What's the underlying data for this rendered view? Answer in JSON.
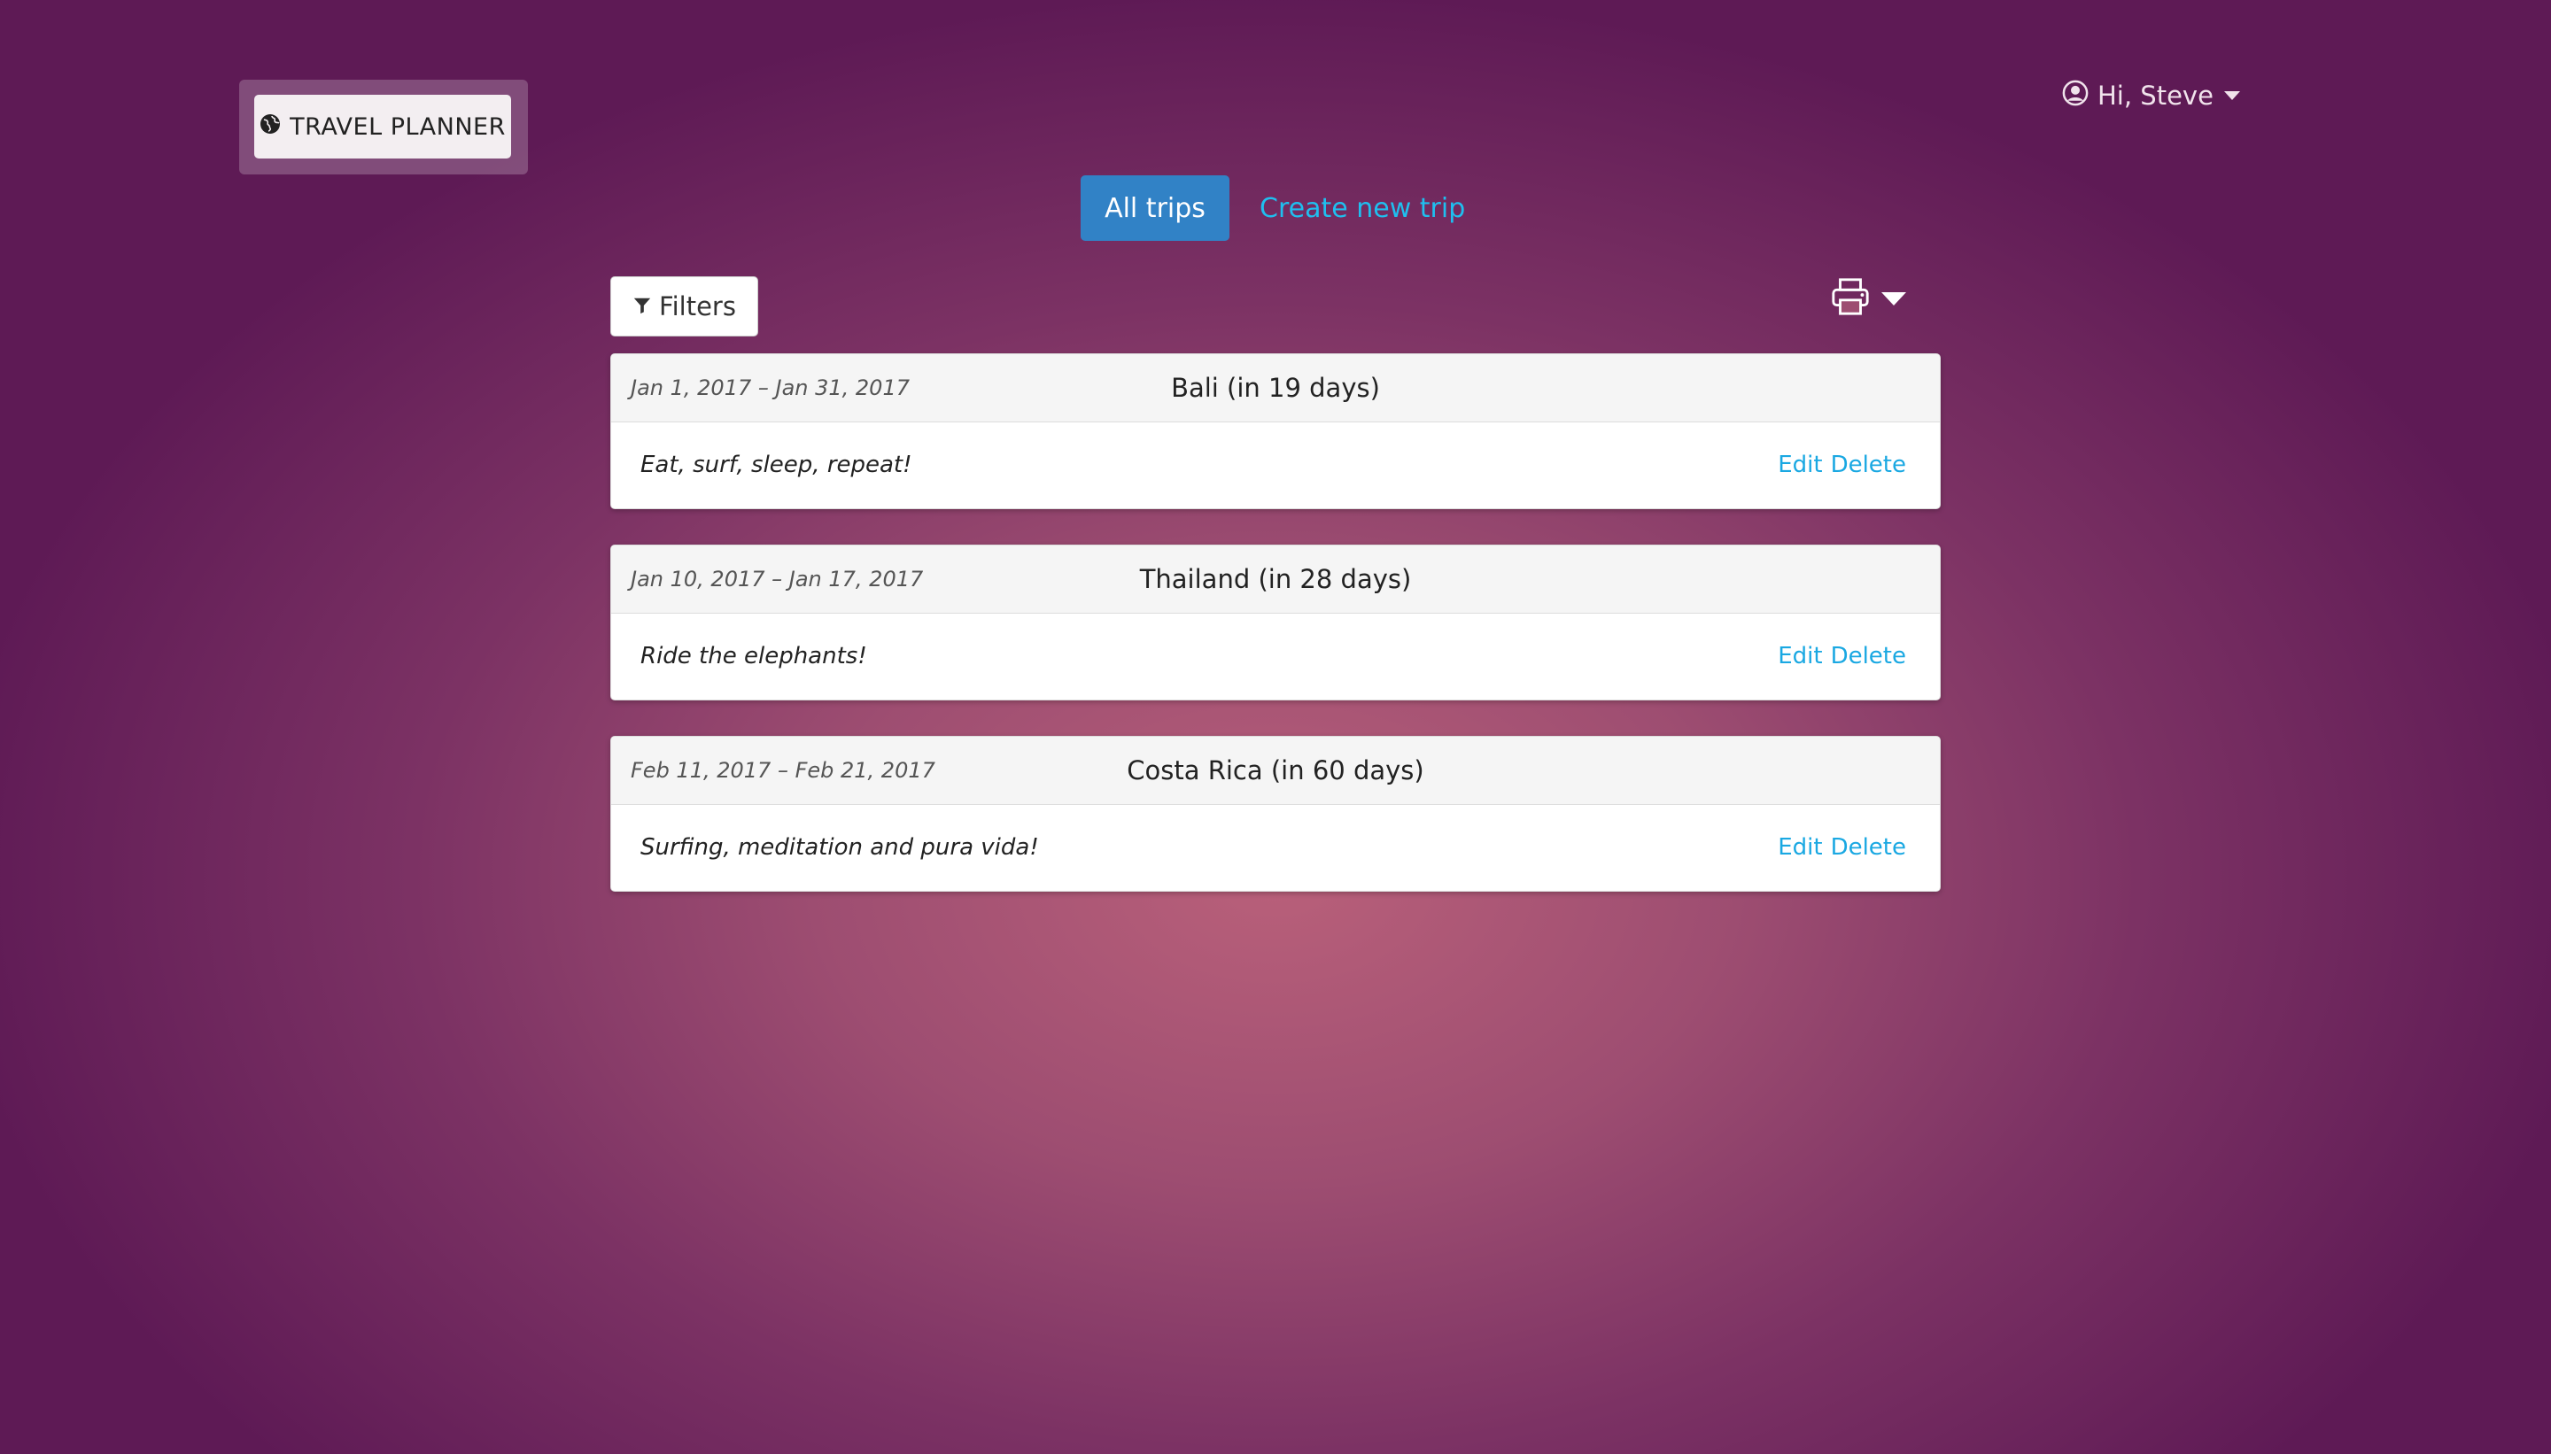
{
  "brand": {
    "label": "TRAVEL PLANNER",
    "icon": "globe-icon"
  },
  "user_menu": {
    "greeting": "Hi, Steve",
    "icon": "user-circle-icon"
  },
  "nav": {
    "active_tab": "All trips",
    "create_link": "Create new trip"
  },
  "toolbar": {
    "filters_label": "Filters",
    "filter_icon": "filter-icon",
    "print_icon": "printer-icon"
  },
  "trips": [
    {
      "dates": "Jan 1, 2017 – Jan 31, 2017",
      "title": "Bali (in 19 days)",
      "description": "Eat, surf, sleep, repeat!",
      "edit": "Edit",
      "delete": "Delete"
    },
    {
      "dates": "Jan 10, 2017 – Jan 17, 2017",
      "title": "Thailand (in 28 days)",
      "description": "Ride the elephants!",
      "edit": "Edit",
      "delete": "Delete"
    },
    {
      "dates": "Feb 11, 2017 – Feb 21, 2017",
      "title": "Costa Rica (in 60 days)",
      "description": "Surfing, meditation and pura vida!",
      "edit": "Edit",
      "delete": "Delete"
    }
  ],
  "colors": {
    "accent": "#3182c6",
    "link": "#1fbfef",
    "action_link": "#1aa8e2",
    "background_center": "#b9607a",
    "background_edge": "#5e1a55"
  }
}
